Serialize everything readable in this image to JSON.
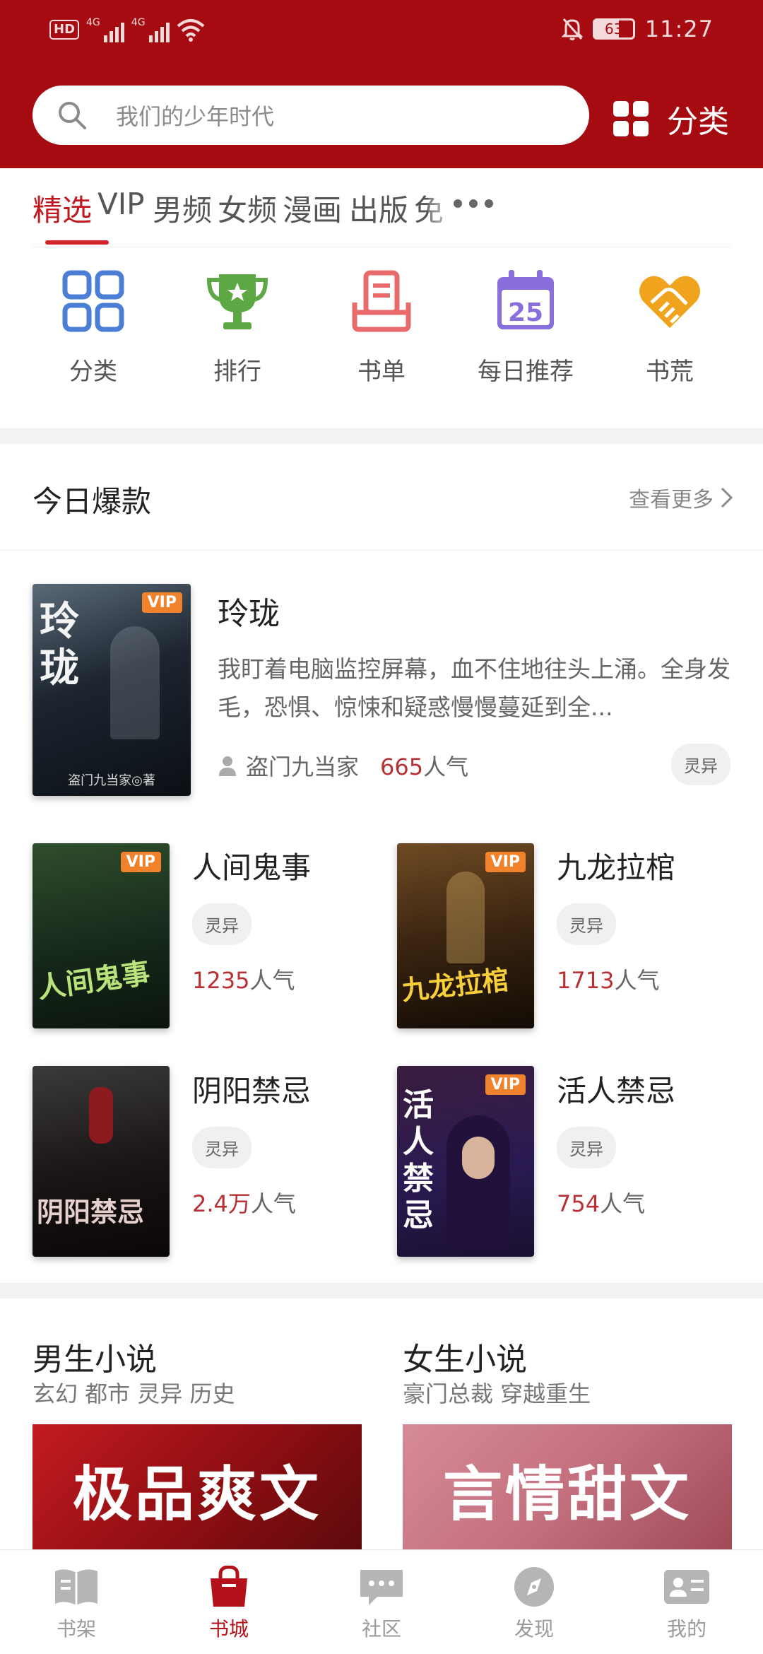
{
  "status_bar": {
    "hd": "HD",
    "net1": "4G",
    "net2": "4G",
    "battery": "63",
    "time": "11:27"
  },
  "search": {
    "placeholder": "我们的少年时代"
  },
  "category_button": {
    "label": "分类"
  },
  "tabs": [
    {
      "label": "精选",
      "active": true
    },
    {
      "label": "VIP"
    },
    {
      "label": "男频"
    },
    {
      "label": "女频"
    },
    {
      "label": "漫画"
    },
    {
      "label": "出版"
    },
    {
      "label": "免"
    }
  ],
  "shortcuts": [
    {
      "label": "分类",
      "icon": "grid-icon"
    },
    {
      "label": "排行",
      "icon": "trophy-icon"
    },
    {
      "label": "书单",
      "icon": "booklist-icon"
    },
    {
      "label": "每日推荐",
      "icon": "calendar-icon",
      "day": "25"
    },
    {
      "label": "书荒",
      "icon": "handshake-icon"
    }
  ],
  "hot": {
    "title": "今日爆款",
    "more": "查看更多",
    "featured": {
      "title": "玲珑",
      "desc": "我盯着电脑监控屏幕，血不住地往头上涌。全身发毛，恐惧、惊悚和疑惑慢慢蔓延到全...",
      "author": "盗门九当家",
      "pop_num": "665",
      "pop_unit": "人气",
      "tag": "灵异",
      "vip": "VIP",
      "cover_text": "玲珑",
      "cover_author": "盗门九当家◎著"
    },
    "books": [
      {
        "title": "人间鬼事",
        "tag": "灵异",
        "pop_num": "1235",
        "pop_unit": "人气",
        "vip": "VIP",
        "cover_text": "人间鬼事"
      },
      {
        "title": "九龙拉棺",
        "tag": "灵异",
        "pop_num": "1713",
        "pop_unit": "人气",
        "vip": "VIP",
        "cover_text": "九龙拉棺"
      },
      {
        "title": "阴阳禁忌",
        "tag": "灵异",
        "pop_num": "2.4万",
        "pop_unit": "人气",
        "vip": "",
        "cover_text": "阴阳禁忌"
      },
      {
        "title": "活人禁忌",
        "tag": "灵异",
        "pop_num": "754",
        "pop_unit": "人气",
        "vip": "VIP",
        "cover_text": "活人禁忌"
      }
    ]
  },
  "gender": {
    "male": {
      "title": "男生小说",
      "sub": "玄幻 都市 灵异 历史",
      "banner": "极品爽文"
    },
    "female": {
      "title": "女生小说",
      "sub": "豪门总裁 穿越重生",
      "banner": "言情甜文"
    }
  },
  "bottom_nav": [
    {
      "label": "书架",
      "icon": "bookshelf-icon"
    },
    {
      "label": "书城",
      "icon": "bookstore-icon",
      "active": true
    },
    {
      "label": "社区",
      "icon": "community-icon"
    },
    {
      "label": "发现",
      "icon": "compass-icon"
    },
    {
      "label": "我的",
      "icon": "profile-icon"
    }
  ],
  "colors": {
    "brand_red": "#a50b10",
    "accent_red": "#d1242b",
    "popularity_red": "#b83033",
    "vip_orange": "#f0822c"
  }
}
